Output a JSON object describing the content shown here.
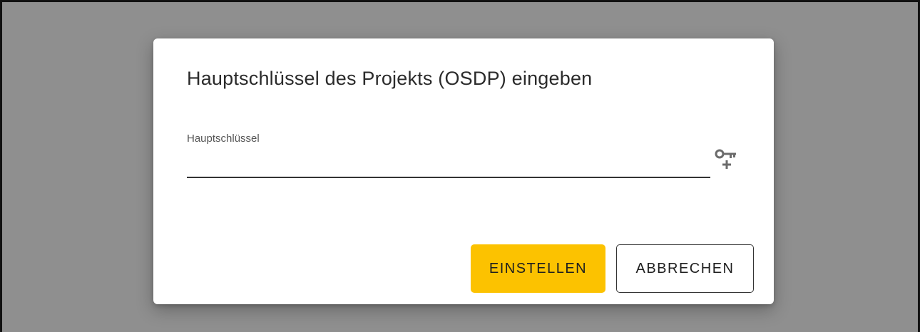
{
  "dialog": {
    "title": "Hauptschlüssel des Projekts (OSDP) eingeben",
    "field": {
      "label": "Hauptschlüssel",
      "value": "",
      "icon": "key-add-icon"
    },
    "buttons": {
      "confirm_label": "EINSTELLEN",
      "cancel_label": "ABBRECHEN"
    }
  },
  "colors": {
    "overlay": "#8f8f8f",
    "dialog_background": "#ffffff",
    "primary_button": "#fcc200",
    "text": "#2b2b2b"
  }
}
